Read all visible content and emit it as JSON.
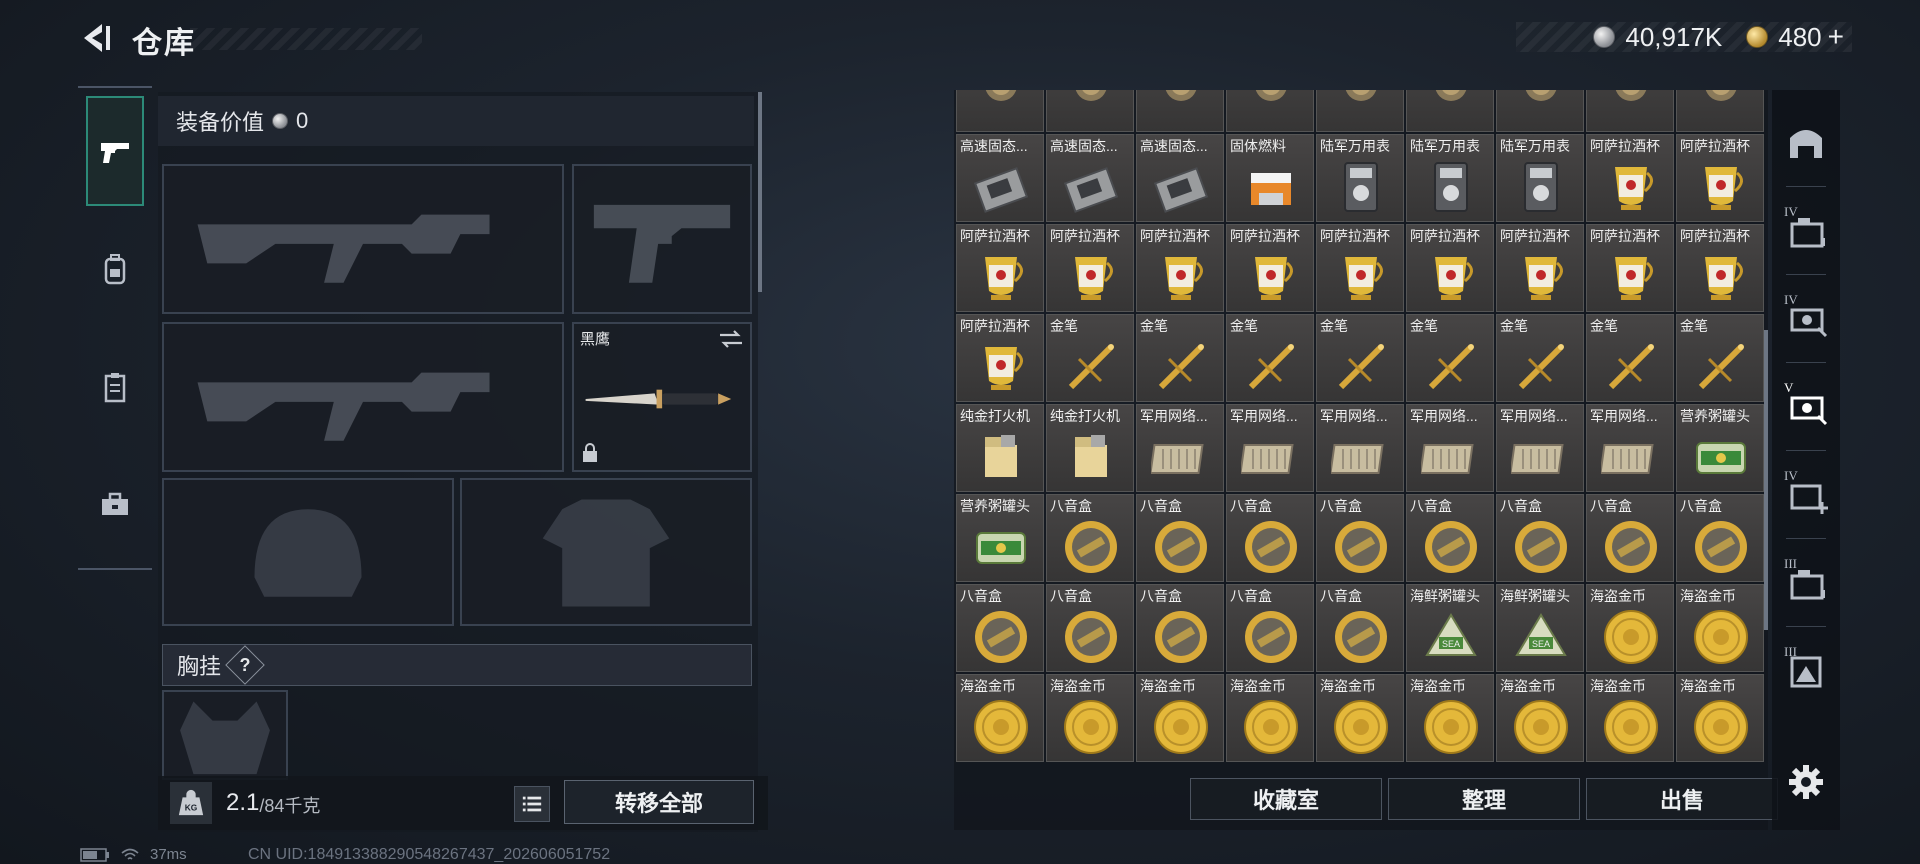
{
  "header": {
    "title": "仓库",
    "currency": [
      {
        "name": "silver-coin",
        "value": "40,917K"
      },
      {
        "name": "gold-coin",
        "value": "480",
        "suffix": "+"
      }
    ]
  },
  "left_nav": {
    "items": [
      {
        "name": "weapons",
        "icon": "pistol-icon",
        "active": true
      },
      {
        "name": "backpack",
        "icon": "backpack-icon",
        "active": false
      },
      {
        "name": "clipboard",
        "icon": "clipboard-icon",
        "active": false
      },
      {
        "name": "toolbox",
        "icon": "toolbox-icon",
        "active": false
      }
    ]
  },
  "equipment": {
    "value_label": "装备价值",
    "value": "0",
    "knife_name": "黑鹰",
    "chest_label": "胸挂",
    "chest_help": "?"
  },
  "bottom_bar": {
    "weight_current": "2.1",
    "weight_max": "/84千克",
    "transfer_all": "转移全部"
  },
  "status": {
    "ping": "37ms",
    "uid": "CN UID:184913388290548267437_202606051752"
  },
  "storage": {
    "rows": [
      [
        {
          "label": "",
          "icon": "medal"
        },
        {
          "label": "",
          "icon": "medal"
        },
        {
          "label": "",
          "icon": "medal"
        },
        {
          "label": "",
          "icon": "medal"
        },
        {
          "label": "",
          "icon": "medal"
        },
        {
          "label": "",
          "icon": "medal"
        },
        {
          "label": "",
          "icon": "medal"
        },
        {
          "label": "",
          "icon": "medal"
        },
        {
          "label": "",
          "icon": "medal"
        }
      ],
      [
        {
          "label": "高速固态...",
          "icon": "ssd"
        },
        {
          "label": "高速固态...",
          "icon": "ssd"
        },
        {
          "label": "高速固态...",
          "icon": "ssd"
        },
        {
          "label": "固体燃料",
          "icon": "fuel"
        },
        {
          "label": "陆军万用表",
          "icon": "multimeter"
        },
        {
          "label": "陆军万用表",
          "icon": "multimeter"
        },
        {
          "label": "陆军万用表",
          "icon": "multimeter"
        },
        {
          "label": "阿萨拉酒杯",
          "icon": "cup"
        },
        {
          "label": "阿萨拉酒杯",
          "icon": "cup"
        }
      ],
      [
        {
          "label": "阿萨拉酒杯",
          "icon": "cup"
        },
        {
          "label": "阿萨拉酒杯",
          "icon": "cup"
        },
        {
          "label": "阿萨拉酒杯",
          "icon": "cup"
        },
        {
          "label": "阿萨拉酒杯",
          "icon": "cup"
        },
        {
          "label": "阿萨拉酒杯",
          "icon": "cup"
        },
        {
          "label": "阿萨拉酒杯",
          "icon": "cup"
        },
        {
          "label": "阿萨拉酒杯",
          "icon": "cup"
        },
        {
          "label": "阿萨拉酒杯",
          "icon": "cup"
        },
        {
          "label": "阿萨拉酒杯",
          "icon": "cup"
        }
      ],
      [
        {
          "label": "阿萨拉酒杯",
          "icon": "cup"
        },
        {
          "label": "金笔",
          "icon": "pen"
        },
        {
          "label": "金笔",
          "icon": "pen"
        },
        {
          "label": "金笔",
          "icon": "pen"
        },
        {
          "label": "金笔",
          "icon": "pen"
        },
        {
          "label": "金笔",
          "icon": "pen"
        },
        {
          "label": "金笔",
          "icon": "pen"
        },
        {
          "label": "金笔",
          "icon": "pen"
        },
        {
          "label": "金笔",
          "icon": "pen"
        }
      ],
      [
        {
          "label": "纯金打火机",
          "icon": "lighter"
        },
        {
          "label": "纯金打火机",
          "icon": "lighter"
        },
        {
          "label": "军用网络...",
          "icon": "network"
        },
        {
          "label": "军用网络...",
          "icon": "network"
        },
        {
          "label": "军用网络...",
          "icon": "network"
        },
        {
          "label": "军用网络...",
          "icon": "network"
        },
        {
          "label": "军用网络...",
          "icon": "network"
        },
        {
          "label": "军用网络...",
          "icon": "network"
        },
        {
          "label": "营养粥罐头",
          "icon": "can"
        }
      ],
      [
        {
          "label": "营养粥罐头",
          "icon": "can"
        },
        {
          "label": "八音盒",
          "icon": "musicbox"
        },
        {
          "label": "八音盒",
          "icon": "musicbox"
        },
        {
          "label": "八音盒",
          "icon": "musicbox"
        },
        {
          "label": "八音盒",
          "icon": "musicbox"
        },
        {
          "label": "八音盒",
          "icon": "musicbox"
        },
        {
          "label": "八音盒",
          "icon": "musicbox"
        },
        {
          "label": "八音盒",
          "icon": "musicbox"
        },
        {
          "label": "八音盒",
          "icon": "musicbox"
        }
      ],
      [
        {
          "label": "八音盒",
          "icon": "musicbox"
        },
        {
          "label": "八音盒",
          "icon": "musicbox"
        },
        {
          "label": "八音盒",
          "icon": "musicbox"
        },
        {
          "label": "八音盒",
          "icon": "musicbox"
        },
        {
          "label": "八音盒",
          "icon": "musicbox"
        },
        {
          "label": "海鲜粥罐头",
          "icon": "tincan"
        },
        {
          "label": "海鲜粥罐头",
          "icon": "tincan"
        },
        {
          "label": "海盗金币",
          "icon": "coin"
        },
        {
          "label": "海盗金币",
          "icon": "coin"
        }
      ],
      [
        {
          "label": "海盗金币",
          "icon": "coin"
        },
        {
          "label": "海盗金币",
          "icon": "coin"
        },
        {
          "label": "海盗金币",
          "icon": "coin"
        },
        {
          "label": "海盗金币",
          "icon": "coin"
        },
        {
          "label": "海盗金币",
          "icon": "coin"
        },
        {
          "label": "海盗金币",
          "icon": "coin"
        },
        {
          "label": "海盗金币",
          "icon": "coin"
        },
        {
          "label": "海盗金币",
          "icon": "coin"
        },
        {
          "label": "海盗金币",
          "icon": "coin"
        }
      ]
    ],
    "buttons": {
      "collection": "收藏室",
      "organize": "整理",
      "sell": "出售"
    }
  },
  "right_tabs": [
    {
      "name": "tab-all",
      "icon": "home-icon",
      "roman": ""
    },
    {
      "name": "tab-iv-storage",
      "icon": "storage-box-icon",
      "roman": "IV"
    },
    {
      "name": "tab-iv-money",
      "icon": "money-icon",
      "roman": "IV"
    },
    {
      "name": "tab-v-money",
      "icon": "money-icon",
      "roman": "V",
      "active": true
    },
    {
      "name": "tab-iv-medical",
      "icon": "medkit-icon",
      "roman": "IV"
    },
    {
      "name": "tab-iii-storage",
      "icon": "storage-box-icon",
      "roman": "III"
    },
    {
      "name": "tab-iii-map",
      "icon": "map-icon",
      "roman": "III"
    }
  ]
}
